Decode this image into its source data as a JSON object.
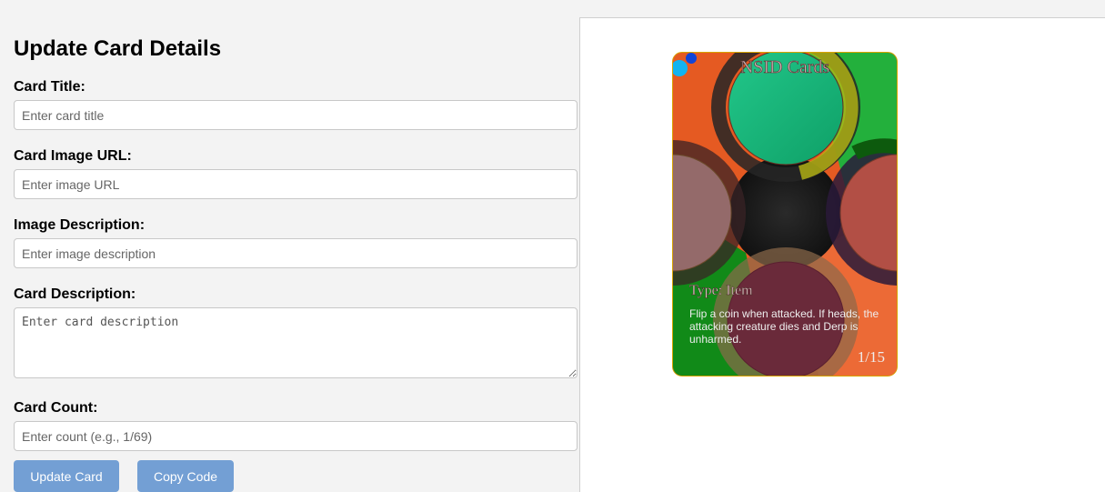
{
  "form": {
    "title": "Update Card Details",
    "fields": [
      {
        "label": "Card Title:",
        "placeholder": "Enter card title"
      },
      {
        "label": "Card Image URL:",
        "placeholder": "Enter image URL"
      },
      {
        "label": "Image Description:",
        "placeholder": "Enter image description"
      },
      {
        "label": "Card Description:",
        "placeholder": "Enter card description"
      },
      {
        "label": "Card Count:",
        "placeholder": "Enter count (e.g., 1/69)"
      }
    ],
    "buttons": {
      "update_label": "Update Card",
      "copy_label": "Copy Code"
    }
  },
  "card": {
    "brand": "NSID Cards",
    "type": "Type: Item",
    "description": "Flip a coin when attacked. If heads, the attacking creature dies and Derp is unharmed.",
    "count": "1/15"
  },
  "colors": {
    "button": "#739fd4",
    "card_border": "#d9a400",
    "card_base": "#e45b22"
  }
}
